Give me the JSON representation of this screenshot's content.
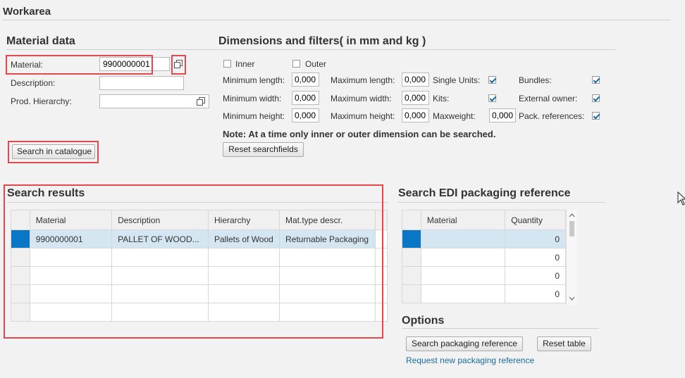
{
  "workarea": {
    "title": "Workarea"
  },
  "material_data": {
    "title": "Material data",
    "material_label": "Material:",
    "material_value": "9900000001",
    "description_label": "Description:",
    "description_value": "",
    "prod_hierarchy_label": "Prod. Hierarchy:",
    "prod_hierarchy_value": "",
    "search_button": "Search in catalogue"
  },
  "dimensions": {
    "title": "Dimensions and filters( in mm and kg )",
    "inner_label": "Inner",
    "outer_label": "Outer",
    "inner_checked": false,
    "outer_checked": false,
    "min_length_label": "Minimum length:",
    "min_length_value": "0,000",
    "max_length_label": "Maximum length:",
    "max_length_value": "0,000",
    "min_width_label": "Minimum width:",
    "min_width_value": "0,000",
    "max_width_label": "Maximum width:",
    "max_width_value": "0,000",
    "min_height_label": "Minimum height:",
    "min_height_value": "0,000",
    "max_height_label": "Maximum height:",
    "max_height_value": "0,000",
    "single_units_label": "Single Units:",
    "kits_label": "Kits:",
    "maxweight_label": "Maxweight:",
    "maxweight_value": "0,000",
    "bundles_label": "Bundles:",
    "external_owner_label": "External owner:",
    "pack_references_label": "Pack. references:",
    "single_units_checked": true,
    "kits_checked": true,
    "bundles_checked": true,
    "external_owner_checked": true,
    "pack_references_checked": true,
    "note": "Note: At a time only inner or outer dimension can be searched.",
    "reset_button": "Reset searchfields"
  },
  "search_results": {
    "title": "Search results",
    "columns": [
      "Material",
      "Description",
      "Hierarchy",
      "Mat.type descr."
    ],
    "rows": [
      [
        "9900000001",
        "PALLET OF WOOD...",
        "Pallets of Wood",
        "Returnable Packaging"
      ],
      [
        "",
        "",
        "",
        ""
      ],
      [
        "",
        "",
        "",
        ""
      ],
      [
        "",
        "",
        "",
        ""
      ],
      [
        "",
        "",
        "",
        ""
      ]
    ]
  },
  "edi": {
    "title": "Search EDI packaging reference",
    "columns": [
      "Material",
      "Quantity"
    ],
    "rows": [
      [
        "",
        "0"
      ],
      [
        "",
        "0"
      ],
      [
        "",
        "0"
      ],
      [
        "",
        "0"
      ]
    ]
  },
  "options": {
    "title": "Options",
    "search_button": "Search packaging reference",
    "reset_button": "Reset table",
    "request_link": "Request new packaging reference"
  },
  "colors": {
    "highlight_red": "#e2494e",
    "selection_blue": "#0a76c6",
    "row_highlight": "#d5e6f3",
    "link": "#1a6ba0"
  }
}
